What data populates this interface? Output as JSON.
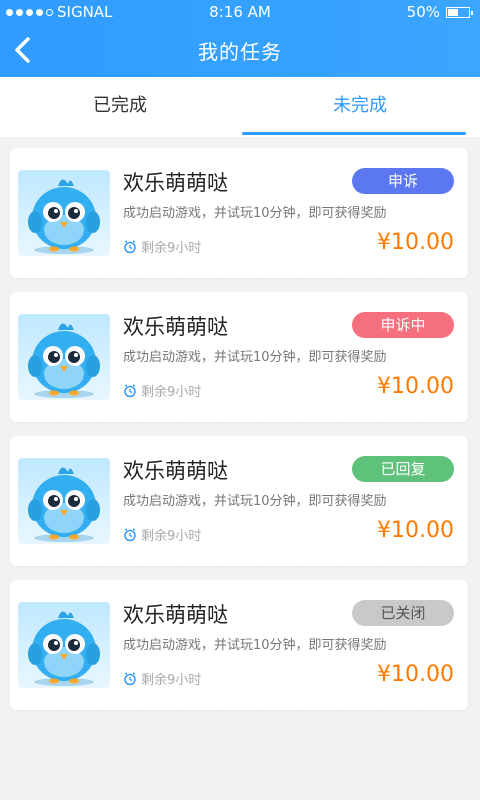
{
  "statusbar": {
    "carrier": "SIGNAL",
    "time": "8:16 AM",
    "battery": "50%"
  },
  "header": {
    "title": "我的任务"
  },
  "tabs": [
    {
      "label": "已完成",
      "active": false
    },
    {
      "label": "未完成",
      "active": true
    }
  ],
  "tasks": [
    {
      "title": "欢乐萌萌哒",
      "desc": "成功启动游戏，并试玩10分钟，即可获得奖励",
      "remaining": "剩余9小时",
      "price": "¥10.00",
      "tag": "申诉",
      "tag_color": "#5b78f0"
    },
    {
      "title": "欢乐萌萌哒",
      "desc": "成功启动游戏，并试玩10分钟，即可获得奖励",
      "remaining": "剩余9小时",
      "price": "¥10.00",
      "tag": "申诉中",
      "tag_color": "#f56f7f"
    },
    {
      "title": "欢乐萌萌哒",
      "desc": "成功启动游戏，并试玩10分钟，即可获得奖励",
      "remaining": "剩余9小时",
      "price": "¥10.00",
      "tag": "已回复",
      "tag_color": "#5ec27b"
    },
    {
      "title": "欢乐萌萌哒",
      "desc": "成功启动游戏，并试玩10分钟，即可获得奖励",
      "remaining": "剩余9小时",
      "price": "¥10.00",
      "tag": "已关闭",
      "tag_color": "#c9c9c9",
      "tag_text_color": "#555555"
    }
  ]
}
